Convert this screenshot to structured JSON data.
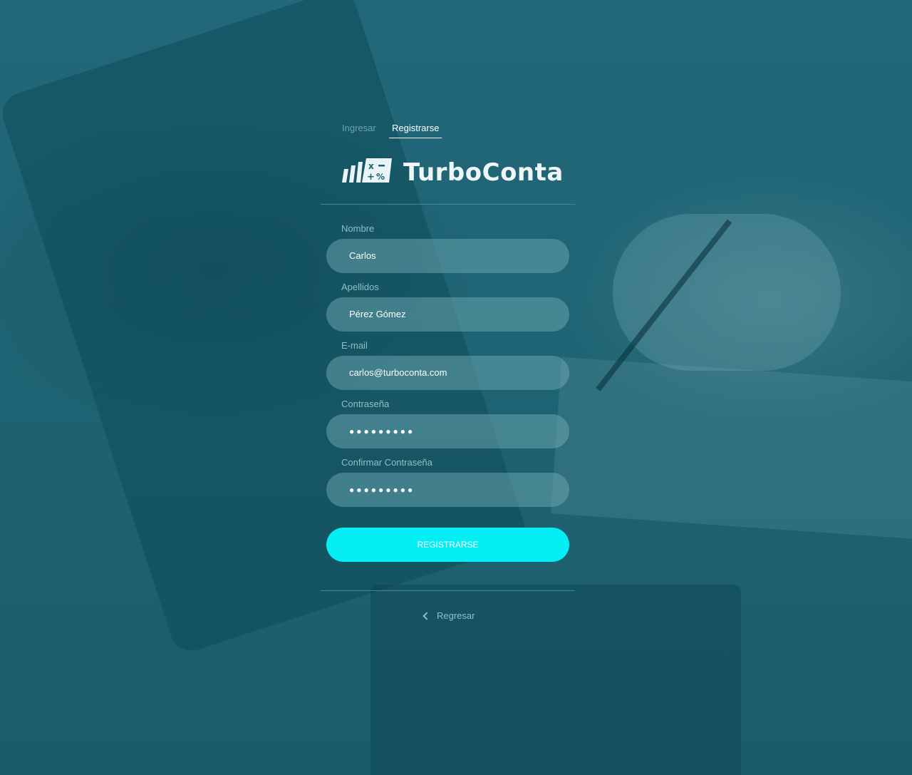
{
  "tabs": {
    "login_label": "Ingresar",
    "register_label": "Registrarse"
  },
  "brand": {
    "name": "TurboConta",
    "logo_icon": "calculator-bars-logo"
  },
  "form": {
    "first_name": {
      "label": "Nombre",
      "value": "Carlos"
    },
    "last_name": {
      "label": "Apellidos",
      "value": "Pérez Gómez"
    },
    "email": {
      "label": "E-mail",
      "value": "carlos@turboconta.com"
    },
    "password": {
      "label": "Contraseña",
      "value": "●●●●●●●●●"
    },
    "confirm_password": {
      "label": "Confirmar Contraseña",
      "value": "●●●●●●●●●"
    },
    "submit_label": "REGISTRARSE"
  },
  "footer": {
    "back_label": "Regresar"
  },
  "colors": {
    "background": "#1e6170",
    "accent": "#05eef5",
    "muted_text": "#8ec0c8"
  }
}
